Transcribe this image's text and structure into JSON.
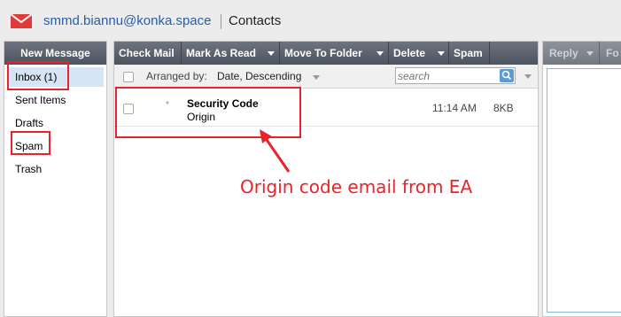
{
  "header": {
    "account_email": "smmd.biannu@konka.space",
    "contacts_link": "Contacts",
    "mail_icon": "envelope-icon"
  },
  "sidebar": {
    "new_message": "New Message",
    "folders": [
      {
        "label": "Inbox (1)",
        "selected": true
      },
      {
        "label": "Sent Items"
      },
      {
        "label": "Drafts"
      },
      {
        "label": "Spam"
      },
      {
        "label": "Trash"
      }
    ]
  },
  "toolbar": {
    "check_mail": "Check Mail",
    "mark_as_read": "Mark As Read",
    "move_to_folder": "Move To Folder",
    "delete": "Delete",
    "spam": "Spam"
  },
  "sortbar": {
    "arranged_by_label": "Arranged by:",
    "arranged_by_value": "Date, Descending",
    "search_placeholder": "search",
    "search_icon": "magnifier-icon"
  },
  "messages": [
    {
      "subject": "Security Code",
      "from": "Origin",
      "time": "11:14 AM",
      "size": "8KB",
      "flag": "*"
    }
  ],
  "reading_pane": {
    "reply": "Reply",
    "forward": "Fo"
  },
  "annotation": {
    "text": "Origin code email from EA",
    "color": "#e8242a"
  },
  "colors": {
    "toolbar": "#555c66",
    "accent_link": "#2a5ca8",
    "selected_folder": "#d6e4f6"
  }
}
